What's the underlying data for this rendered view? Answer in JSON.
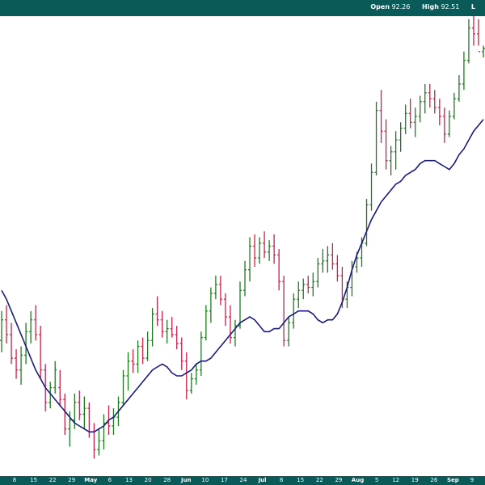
{
  "header": {
    "open_label": "Open",
    "open_value": "92.26",
    "high_label": "High",
    "high_value": "92.51",
    "low_label": "L"
  },
  "chart_data": {
    "type": "ohlc",
    "colors": {
      "up": "#1f7a1f",
      "down": "#cc1f4a",
      "moving_average": "#1a1a80",
      "frame": "#0b5a5a"
    },
    "xlabels": [
      {
        "text": "8",
        "month": false
      },
      {
        "text": "15",
        "month": false
      },
      {
        "text": "22",
        "month": false
      },
      {
        "text": "29",
        "month": false
      },
      {
        "text": "May",
        "month": true
      },
      {
        "text": "6",
        "month": false
      },
      {
        "text": "13",
        "month": false
      },
      {
        "text": "20",
        "month": false
      },
      {
        "text": "28",
        "month": false
      },
      {
        "text": "Jun",
        "month": true
      },
      {
        "text": "10",
        "month": false
      },
      {
        "text": "17",
        "month": false
      },
      {
        "text": "24",
        "month": false
      },
      {
        "text": "Jul",
        "month": true
      },
      {
        "text": "8",
        "month": false
      },
      {
        "text": "15",
        "month": false
      },
      {
        "text": "22",
        "month": false
      },
      {
        "text": "29",
        "month": false
      },
      {
        "text": "Aug",
        "month": true
      },
      {
        "text": "5",
        "month": false
      },
      {
        "text": "12",
        "month": false
      },
      {
        "text": "19",
        "month": false
      },
      {
        "text": "26",
        "month": false
      },
      {
        "text": "Sep",
        "month": true
      },
      {
        "text": "9",
        "month": false
      }
    ],
    "bars": [
      [
        82.6,
        83.6,
        82.2,
        83.3
      ],
      [
        83.3,
        83.8,
        82.5,
        82.8
      ],
      [
        82.8,
        83.2,
        81.8,
        82.0
      ],
      [
        82.0,
        82.3,
        81.3,
        81.6
      ],
      [
        81.6,
        82.4,
        81.1,
        82.1
      ],
      [
        82.1,
        83.2,
        81.8,
        82.9
      ],
      [
        82.9,
        83.6,
        82.5,
        83.3
      ],
      [
        83.3,
        83.8,
        82.6,
        82.8
      ],
      [
        82.8,
        83.1,
        81.3,
        81.6
      ],
      [
        81.6,
        81.8,
        80.2,
        80.5
      ],
      [
        80.5,
        81.2,
        80.3,
        81.0
      ],
      [
        81.0,
        81.9,
        80.8,
        81.6
      ],
      [
        81.0,
        81.6,
        80.4,
        80.6
      ],
      [
        80.6,
        80.8,
        79.4,
        79.6
      ],
      [
        79.6,
        80.2,
        79.0,
        79.9
      ],
      [
        79.9,
        80.8,
        79.6,
        80.5
      ],
      [
        80.5,
        80.9,
        79.9,
        80.1
      ],
      [
        80.1,
        80.7,
        79.6,
        80.3
      ],
      [
        80.3,
        80.5,
        79.3,
        79.5
      ],
      [
        79.5,
        79.8,
        78.6,
        78.9
      ],
      [
        78.9,
        79.6,
        78.7,
        79.2
      ],
      [
        79.2,
        80.1,
        78.9,
        79.8
      ],
      [
        79.8,
        80.4,
        79.4,
        79.7
      ],
      [
        79.7,
        80.3,
        79.4,
        80.0
      ],
      [
        80.0,
        80.7,
        79.7,
        80.5
      ],
      [
        80.5,
        81.6,
        80.4,
        81.4
      ],
      [
        81.4,
        82.2,
        80.9,
        81.9
      ],
      [
        81.9,
        82.3,
        81.5,
        81.8
      ],
      [
        81.8,
        82.6,
        81.5,
        82.4
      ],
      [
        82.4,
        82.7,
        81.8,
        82.0
      ],
      [
        82.0,
        82.9,
        81.9,
        82.6
      ],
      [
        82.6,
        83.7,
        82.4,
        83.5
      ],
      [
        83.5,
        84.1,
        83.1,
        83.3
      ],
      [
        83.3,
        83.6,
        82.7,
        82.9
      ],
      [
        82.9,
        83.3,
        82.5,
        83.0
      ],
      [
        83.0,
        83.4,
        82.7,
        82.8
      ],
      [
        82.8,
        83.1,
        82.3,
        82.5
      ],
      [
        82.5,
        82.7,
        81.6,
        81.9
      ],
      [
        81.9,
        82.2,
        80.6,
        80.9
      ],
      [
        80.9,
        81.5,
        80.8,
        81.3
      ],
      [
        81.3,
        81.8,
        81.1,
        81.6
      ],
      [
        81.6,
        82.9,
        81.4,
        82.7
      ],
      [
        82.7,
        83.8,
        82.6,
        83.6
      ],
      [
        83.6,
        84.4,
        83.2,
        84.2
      ],
      [
        84.2,
        84.8,
        84.0,
        84.5
      ],
      [
        84.5,
        84.8,
        83.8,
        84.0
      ],
      [
        84.0,
        84.2,
        83.1,
        83.4
      ],
      [
        83.4,
        83.8,
        82.5,
        82.7
      ],
      [
        82.7,
        83.3,
        82.4,
        83.1
      ],
      [
        83.1,
        84.6,
        83.0,
        84.3
      ],
      [
        84.3,
        85.3,
        84.1,
        85.0
      ],
      [
        85.0,
        86.1,
        84.6,
        85.8
      ],
      [
        85.8,
        86.2,
        85.1,
        85.4
      ],
      [
        85.4,
        86.1,
        85.2,
        85.9
      ],
      [
        85.9,
        86.3,
        85.4,
        85.6
      ],
      [
        85.6,
        86.0,
        85.3,
        85.8
      ],
      [
        85.8,
        86.2,
        85.2,
        85.5
      ],
      [
        85.5,
        85.7,
        84.3,
        84.6
      ],
      [
        84.6,
        84.8,
        82.4,
        82.6
      ],
      [
        82.6,
        83.4,
        82.4,
        83.2
      ],
      [
        83.2,
        84.2,
        83.0,
        84.0
      ],
      [
        84.0,
        84.6,
        83.7,
        84.3
      ],
      [
        84.3,
        84.7,
        84.0,
        84.5
      ],
      [
        84.5,
        84.8,
        84.2,
        84.4
      ],
      [
        84.4,
        84.9,
        84.1,
        84.6
      ],
      [
        84.6,
        85.4,
        84.4,
        85.2
      ],
      [
        85.2,
        85.7,
        84.9,
        85.3
      ],
      [
        85.3,
        85.8,
        84.9,
        85.5
      ],
      [
        85.5,
        85.9,
        85.0,
        85.2
      ],
      [
        85.2,
        85.5,
        84.6,
        84.8
      ],
      [
        84.8,
        85.1,
        83.7,
        84.0
      ],
      [
        84.0,
        84.6,
        83.7,
        84.4
      ],
      [
        84.4,
        85.3,
        84.1,
        85.1
      ],
      [
        85.1,
        85.6,
        84.9,
        85.4
      ],
      [
        85.4,
        86.1,
        85.1,
        85.9
      ],
      [
        85.9,
        87.4,
        85.8,
        87.2
      ],
      [
        87.2,
        88.6,
        87.0,
        88.3
      ],
      [
        88.3,
        90.7,
        88.2,
        90.4
      ],
      [
        90.4,
        91.1,
        89.3,
        89.7
      ],
      [
        89.7,
        90.1,
        88.4,
        88.7
      ],
      [
        88.7,
        89.2,
        88.2,
        89.0
      ],
      [
        89.0,
        89.7,
        88.4,
        89.4
      ],
      [
        89.4,
        90.0,
        89.0,
        89.8
      ],
      [
        89.8,
        90.6,
        89.6,
        90.3
      ],
      [
        90.3,
        90.8,
        89.8,
        90.0
      ],
      [
        90.0,
        90.5,
        89.5,
        90.2
      ],
      [
        90.2,
        90.9,
        90.0,
        90.7
      ],
      [
        90.7,
        91.3,
        90.3,
        91.0
      ],
      [
        91.0,
        91.3,
        90.5,
        90.8
      ],
      [
        90.8,
        91.1,
        90.3,
        90.5
      ],
      [
        90.5,
        90.8,
        89.9,
        90.2
      ],
      [
        90.2,
        90.5,
        89.3,
        89.6
      ],
      [
        89.6,
        90.4,
        89.5,
        90.2
      ],
      [
        90.2,
        91.0,
        90.1,
        90.8
      ],
      [
        90.8,
        91.6,
        90.7,
        91.3
      ],
      [
        91.3,
        92.4,
        91.1,
        92.1
      ],
      [
        92.1,
        93.5,
        92.0,
        93.2
      ],
      [
        93.2,
        93.7,
        92.6,
        93.0
      ],
      [
        93.0,
        93.5,
        92.6,
        92.4
      ],
      [
        92.4,
        92.6,
        92.2,
        92.5
      ]
    ],
    "moving_average": [
      84.3,
      84.0,
      83.6,
      83.2,
      82.8,
      82.4,
      82.0,
      81.6,
      81.3,
      81.0,
      80.8,
      80.6,
      80.4,
      80.2,
      80.0,
      79.8,
      79.7,
      79.6,
      79.5,
      79.5,
      79.6,
      79.7,
      79.9,
      80.0,
      80.2,
      80.4,
      80.6,
      80.8,
      81.0,
      81.2,
      81.4,
      81.6,
      81.7,
      81.8,
      81.7,
      81.5,
      81.4,
      81.4,
      81.5,
      81.6,
      81.8,
      81.9,
      81.9,
      82.0,
      82.2,
      82.4,
      82.6,
      82.8,
      83.0,
      83.2,
      83.3,
      83.4,
      83.3,
      83.1,
      82.9,
      82.9,
      83.0,
      83.0,
      83.2,
      83.4,
      83.5,
      83.6,
      83.6,
      83.6,
      83.5,
      83.3,
      83.2,
      83.3,
      83.3,
      83.5,
      83.9,
      84.4,
      85.0,
      85.5,
      85.9,
      86.3,
      86.7,
      87.0,
      87.3,
      87.5,
      87.7,
      87.9,
      88.0,
      88.2,
      88.3,
      88.4,
      88.6,
      88.7,
      88.7,
      88.7,
      88.6,
      88.5,
      88.4,
      88.6,
      88.9,
      89.1,
      89.4,
      89.7,
      89.9,
      90.1
    ],
    "ylim": [
      78.0,
      93.6
    ]
  }
}
